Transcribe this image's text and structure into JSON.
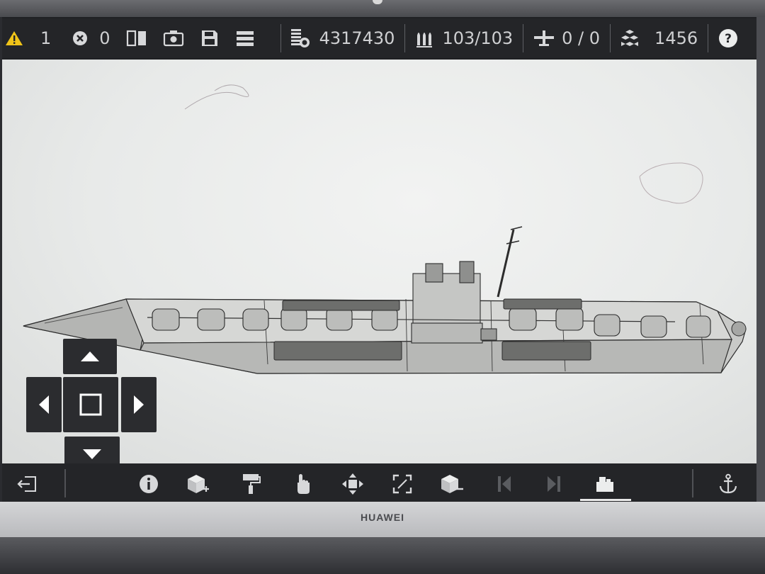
{
  "device": {
    "brand": "HUAWEI"
  },
  "topbar": {
    "warnings": {
      "icon": "warning-icon",
      "count": "1"
    },
    "errors": {
      "icon": "error-icon",
      "count": "0"
    },
    "tools": [
      "mirror-icon",
      "camera-icon",
      "save-icon",
      "menu-icon"
    ],
    "cost": {
      "icon": "cost-icon",
      "value": "4317430"
    },
    "ammo": {
      "icon": "ammo-icon",
      "value": "103/103"
    },
    "aircraft": {
      "icon": "aircraft-icon",
      "value": "0 / 0"
    },
    "blocks": {
      "icon": "blocks-icon",
      "value": "1456"
    },
    "help": {
      "icon": "help-icon"
    }
  },
  "dpad": [
    "arrow-up-icon",
    "arrow-left-icon",
    "center-square-icon",
    "arrow-right-icon",
    "arrow-down-icon"
  ],
  "bottombar": {
    "items": [
      "exit-icon",
      "info-icon",
      "add-block-icon",
      "paint-roller-icon",
      "hand-pointer-icon",
      "move-icon",
      "resize-icon",
      "remove-block-icon",
      "prev-icon",
      "next-icon",
      "build-icon",
      "anchor-icon"
    ],
    "active": "build-icon"
  },
  "colors": {
    "bar_bg": "#242528",
    "icon": "#d7d8da",
    "warning": "#f0c419",
    "active_underline": "#e9e9e9"
  }
}
